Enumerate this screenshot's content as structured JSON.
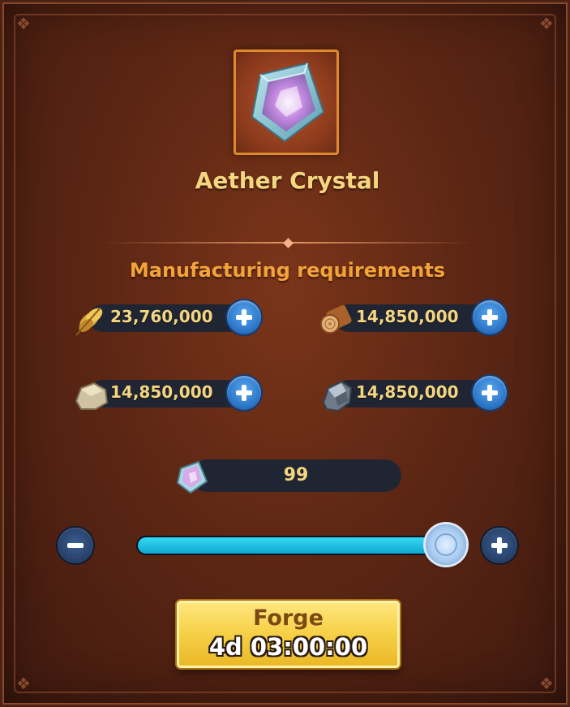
{
  "item": {
    "name": "Aether Crystal",
    "icon": "aether-crystal-icon"
  },
  "requirements": {
    "title": "Manufacturing requirements",
    "resources": [
      {
        "icon": "wheat-icon",
        "value": "23,760,000"
      },
      {
        "icon": "wood-log-icon",
        "value": "14,850,000"
      },
      {
        "icon": "stone-icon",
        "value": "14,850,000"
      },
      {
        "icon": "iron-ore-icon",
        "value": "14,850,000"
      }
    ]
  },
  "quantity": {
    "value": "99",
    "slider_fraction": 0.96
  },
  "forge": {
    "label": "Forge",
    "time": "4d 03:00:00"
  },
  "colors": {
    "accent_gold": "#f5d680",
    "requirements_orange": "#f3a33a",
    "slider_cyan": "#1cc0e6",
    "button_yellow": "#f7d24a"
  }
}
